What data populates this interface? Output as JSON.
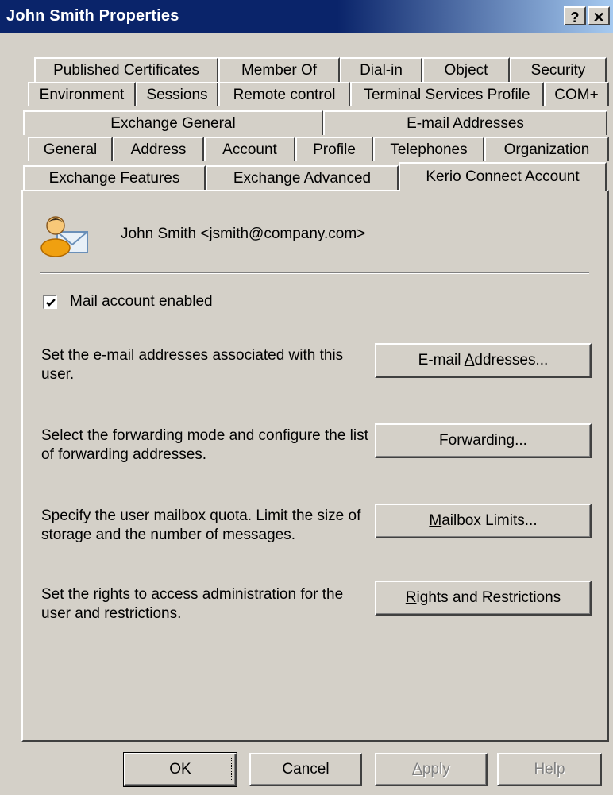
{
  "window": {
    "title": "John Smith Properties",
    "help_button": "?",
    "close_button": "✕"
  },
  "tabs": {
    "row1": [
      "Published Certificates",
      "Member Of",
      "Dial-in",
      "Object",
      "Security"
    ],
    "row2": [
      "Environment",
      "Sessions",
      "Remote control",
      "Terminal Services Profile",
      "COM+"
    ],
    "row3": [
      "Exchange General",
      "E-mail Addresses"
    ],
    "row4": [
      "General",
      "Address",
      "Account",
      "Profile",
      "Telephones",
      "Organization"
    ],
    "row5": [
      "Exchange Features",
      "Exchange Advanced",
      "Kerio Connect Account"
    ],
    "active": "Kerio Connect Account"
  },
  "account": {
    "user_display": "John Smith <jsmith@company.com>",
    "mail_enabled_label_pre": "Mail account ",
    "mail_enabled_label_accel": "e",
    "mail_enabled_label_post": "nabled",
    "mail_enabled_checked": true
  },
  "sections": [
    {
      "description": "Set the e-mail addresses associated with this user.",
      "button_pre": "E-mail ",
      "button_accel": "A",
      "button_post": "ddresses..."
    },
    {
      "description": "Select the forwarding mode and configure the list of forwarding addresses.",
      "button_pre": "",
      "button_accel": "F",
      "button_post": "orwarding..."
    },
    {
      "description": "Specify the user mailbox quota. Limit the size of storage and the number of messages.",
      "button_pre": "",
      "button_accel": "M",
      "button_post": "ailbox Limits..."
    },
    {
      "description": "Set the rights to access administration for the user and restrictions.",
      "button_pre": "",
      "button_accel": "R",
      "button_post": "ights and Restrictions"
    }
  ],
  "footer": {
    "ok": "OK",
    "cancel": "Cancel",
    "apply_accel": "A",
    "apply_post": "pply",
    "help": "Help"
  },
  "colors": {
    "titlebar": "#0a246a",
    "face": "#d4d0c8"
  }
}
